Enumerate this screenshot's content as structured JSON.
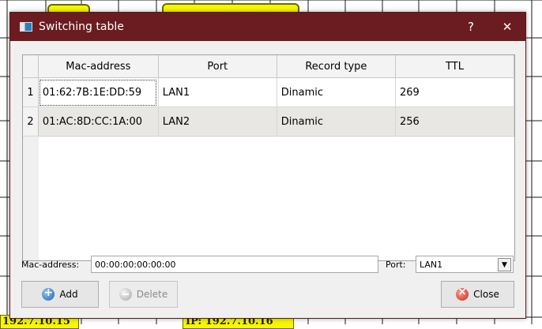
{
  "window": {
    "title": "Switching table",
    "help_button": "?",
    "close_button": "✕"
  },
  "table": {
    "headers": [
      "Mac-address",
      "Port",
      "Record type",
      "TTL"
    ],
    "rows": [
      {
        "num": "1",
        "mac": "01:62:7B:1E:DD:59",
        "port": "LAN1",
        "type": "Dinamic",
        "ttl": "269"
      },
      {
        "num": "2",
        "mac": "01:AC:8D:CC:1A:00",
        "port": "LAN2",
        "type": "Dinamic",
        "ttl": "256"
      }
    ]
  },
  "form": {
    "mac_label": "Mac-address:",
    "mac_value": "00:00:00:00:00:00",
    "port_label": "Port:",
    "port_value": "LAN1"
  },
  "buttons": {
    "add": "Add",
    "delete": "Delete",
    "close": "Close"
  },
  "background": {
    "label_left": "192.7.10.15",
    "label_right": "IP: 192.7.10.16"
  }
}
